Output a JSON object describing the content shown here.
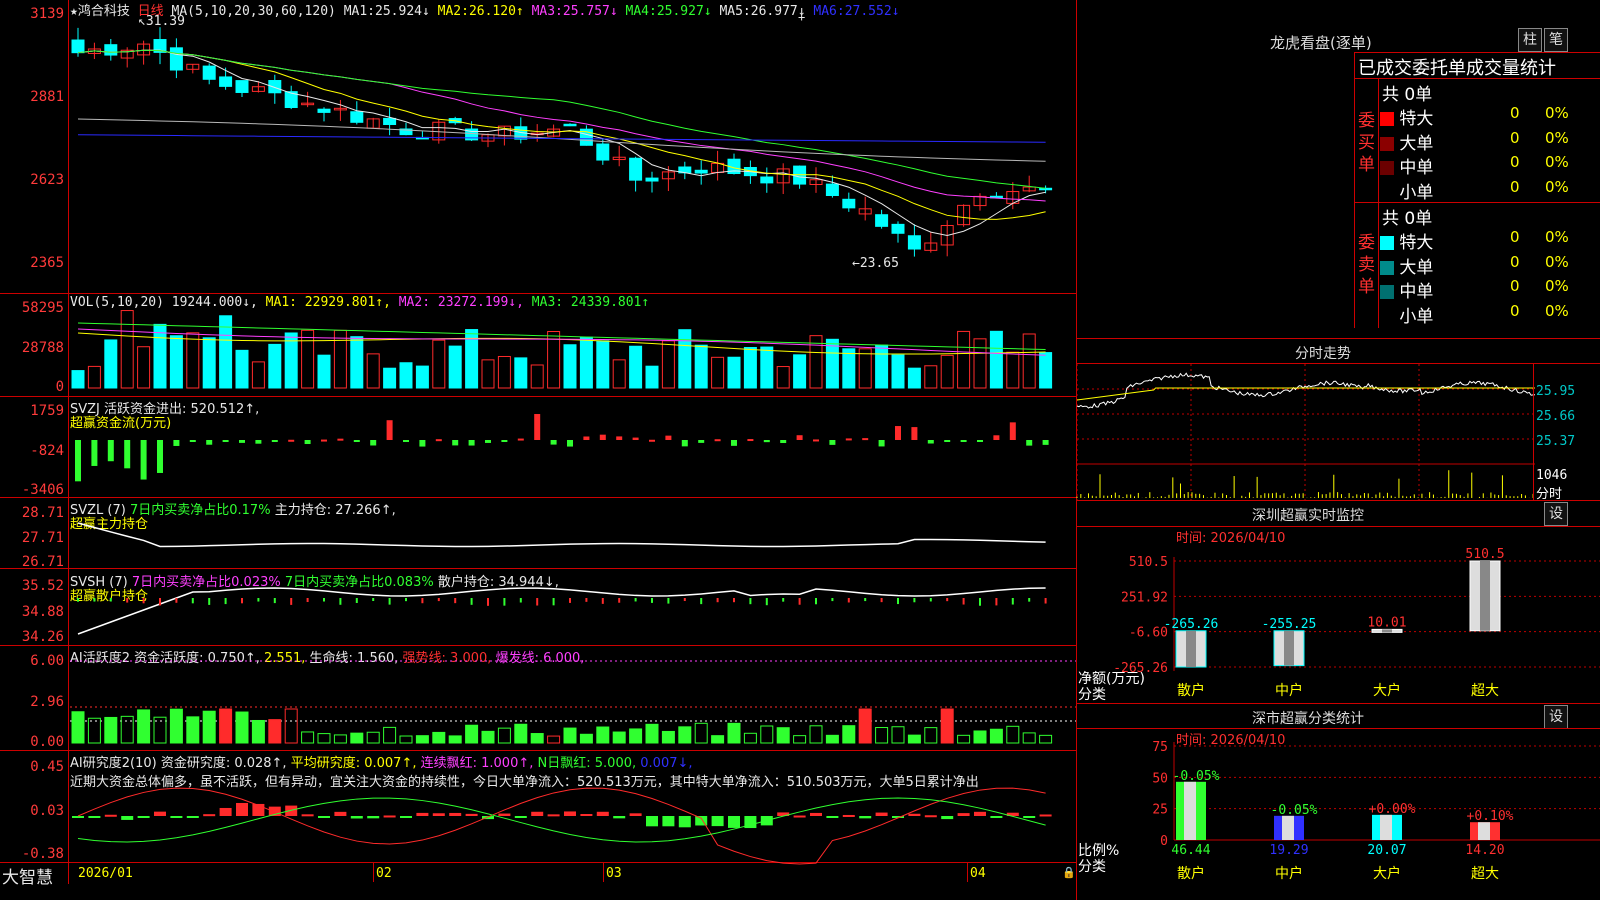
{
  "colors": {
    "up": "#ff2b2b",
    "down": "#00ffff",
    "grid": "#c00000",
    "ma1": "#e8e8e8",
    "ma2": "#ffff00",
    "ma3": "#ff40ff",
    "ma4": "#30ff30",
    "ma5": "#b8b8b8",
    "ma6": "#2a2aff"
  },
  "main": {
    "stock": "★鸿合科技",
    "period": "日线",
    "ma_label": "MA(5,10,20,30,60,120)",
    "ma": [
      {
        "k": "MA1:",
        "v": "25.924↓"
      },
      {
        "k": "MA2:",
        "v": "26.120↑"
      },
      {
        "k": "MA3:",
        "v": "25.757↓"
      },
      {
        "k": "MA4:",
        "v": "25.927↓"
      },
      {
        "k": "MA5:",
        "v": "26.977↓"
      },
      {
        "k": "MA6:",
        "v": "27.552↓"
      }
    ],
    "y_ticks": [
      "3139",
      "2881",
      "2623",
      "2365"
    ],
    "max_label": "31.39",
    "min_label": "23.65"
  },
  "vol": {
    "label": "VOL(5,10,20)",
    "value": "19244.000↓,",
    "ma1": "MA1: 22929.801↑,",
    "ma2": "MA2: 23272.199↓,",
    "ma3": "MA3: 24339.801↑",
    "y_ticks": [
      "58295",
      "28788",
      "0"
    ]
  },
  "svzj": {
    "l1": "SVZJ  活跃资金进出: 520.512↑,",
    "l2": "超赢资金流(万元)",
    "y_ticks": [
      "1759",
      "-824",
      "-3406"
    ]
  },
  "svzl": {
    "a": "SVZL (7)",
    "b": "7日内买卖净占比0.17%",
    "c": "主力持仓: 27.266↑,",
    "l2": "超赢主力持仓",
    "y_ticks": [
      "28.71",
      "27.71",
      "26.71"
    ]
  },
  "svsh": {
    "a": "SVSH (7)",
    "b": "7日内买卖净占比0.023%",
    "c": "7日内买卖净占比0.083%",
    "d": "散户持仓: 34.944↓,",
    "l2": "超赢散户持仓",
    "y_ticks": [
      "35.52",
      "34.88",
      "34.26"
    ]
  },
  "ai1": {
    "a": "AI活跃度2 资金活跃度: 0.750↑,",
    "b": "2.551,",
    "c": "生命线: 1.560,",
    "d": "强势线: 3.000,",
    "e": "爆发线: 6.000,",
    "y_ticks": [
      "6.00",
      "2.96",
      "0.00"
    ]
  },
  "ai2": {
    "a": "AI研究度2(10) 资金研究度: 0.028↑,",
    "b": "平均研究度: 0.007↑,",
    "c": "连续飘红: 1.000↑,",
    "d": "N日飘红: 5.000,",
    "e": "0.007↓,",
    "text": "近期大资金总体偏多，虽不活跃，但有异动，宜关注大资金的持续性，今日大单净流入：520.513万元，其中特大单净流入：510.503万元，大单5日累计净出",
    "y_ticks": [
      "0.45",
      "0.03",
      "-0.38"
    ]
  },
  "xaxis": {
    "brand": "大智慧",
    "labels": [
      "2026/01",
      "02",
      "03",
      "04"
    ]
  },
  "lhb": {
    "title": "龙虎看盘(逐单)",
    "btn1": "柱",
    "btn2": "笔",
    "header": "已成交委托单成交量统计",
    "buy_side": "委买单",
    "sell_side": "委卖单",
    "buy_total": "共 0单",
    "sell_total": "共 0单",
    "buy_rows": [
      {
        "name": "特大",
        "n": "0",
        "p": "0%",
        "c": "#ff0000"
      },
      {
        "name": "大单",
        "n": "0",
        "p": "0%",
        "c": "#8b0000"
      },
      {
        "name": "中单",
        "n": "0",
        "p": "0%",
        "c": "#6b0000"
      },
      {
        "name": "小单",
        "n": "0",
        "p": "0%",
        "c": "#000000"
      }
    ],
    "sell_rows": [
      {
        "name": "特大",
        "n": "0",
        "p": "0%",
        "c": "#00ffff"
      },
      {
        "name": "大单",
        "n": "0",
        "p": "0%",
        "c": "#008b8b"
      },
      {
        "name": "中单",
        "n": "0",
        "p": "0%",
        "c": "#007070"
      },
      {
        "name": "小单",
        "n": "0",
        "p": "0%",
        "c": "#000000"
      }
    ]
  },
  "fenshi": {
    "title": "分时走势",
    "y_ticks": [
      "25.95",
      "25.66",
      "25.37"
    ],
    "vol_tick": "1046",
    "vol_unit": "分时"
  },
  "sz_monitor": {
    "title": "深圳超赢实时监控",
    "btn": "设",
    "time": "时间: 2026/04/10",
    "y_ticks": [
      "510.5",
      "251.92",
      "-6.60",
      "-265.26"
    ],
    "ylabel": "净额(万元)",
    "xlabel": "分类",
    "chart_data": {
      "type": "bar",
      "categories": [
        "散户",
        "中户",
        "大户",
        "超大"
      ],
      "values": [
        -265.26,
        -255.25,
        10.01,
        510.5
      ],
      "value_labels": [
        "-265.26",
        "-255.25",
        "10.01",
        "510.5"
      ],
      "ylim": [
        -265.26,
        510.5
      ]
    }
  },
  "sz_class": {
    "title": "深市超赢分类统计",
    "btn": "设",
    "time": "时间: 2026/04/10",
    "y_ticks": [
      "75",
      "50",
      "25",
      "0"
    ],
    "ylabel": "比例%",
    "xlabel": "分类",
    "chart_data": {
      "type": "bar",
      "categories": [
        "散户",
        "中户",
        "大户",
        "超大"
      ],
      "values": [
        46.44,
        19.29,
        20.07,
        14.2
      ],
      "value_labels": [
        "46.44",
        "19.29",
        "20.07",
        "14.20"
      ],
      "change_labels": [
        "-0.05%",
        "-0.05%",
        "+0.00%",
        "+0.10%"
      ],
      "colors": [
        "#30ff30",
        "#3030ff",
        "#00ffff",
        "#ff3030"
      ],
      "ylim": [
        0,
        75
      ]
    }
  }
}
